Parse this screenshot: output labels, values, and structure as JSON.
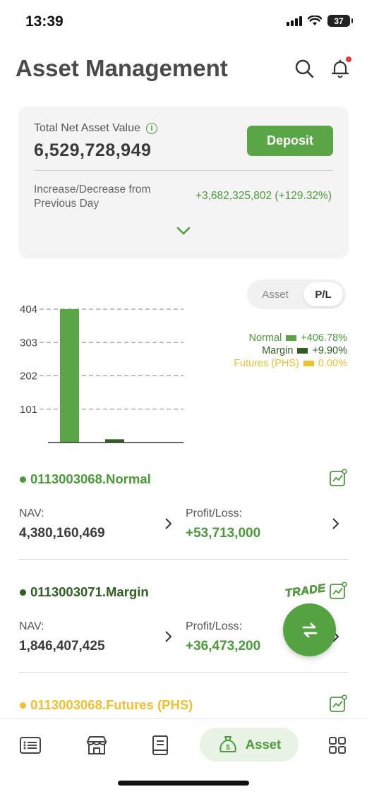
{
  "status_bar": {
    "time": "13:39",
    "battery": "37"
  },
  "header": {
    "title": "Asset Management"
  },
  "summary": {
    "nav_label": "Total Net Asset Value",
    "nav_value": "6,529,728,949",
    "deposit_label": "Deposit",
    "change_label": "Increase/Decrease from Previous Day",
    "change_value": "+3,682,325,802 (+129.32%)"
  },
  "toggle": {
    "asset_label": "Asset",
    "pl_label": "P/L",
    "selected": "P/L"
  },
  "chart_data": {
    "type": "bar",
    "categories": [
      "Normal",
      "Margin",
      "Futures (PHS)"
    ],
    "values": [
      406.78,
      9.9,
      0.0
    ],
    "colors": [
      "#5aa545",
      "#2f5f22",
      "#f0c030"
    ],
    "ytick_labels": [
      "101",
      "202",
      "303",
      "404"
    ],
    "ytick_values": [
      101,
      202,
      303,
      404
    ],
    "ylim": [
      0,
      404
    ],
    "grid": "dashed",
    "legend": [
      {
        "name": "Normal",
        "value": "+406.78%",
        "color": "#4b9a3a"
      },
      {
        "name": "Margin",
        "value": "+9.90%",
        "color": "#2f5f22"
      },
      {
        "name": "Futures (PHS)",
        "value": "0.00%",
        "color": "#f0c030"
      }
    ],
    "legend_position": "right"
  },
  "accounts": [
    {
      "name": "0113003068.Normal",
      "color": "#4b9a3a",
      "nav_label": "NAV:",
      "nav_value": "4,380,160,469",
      "pl_label": "Profit/Loss:",
      "pl_value": "+53,713,000"
    },
    {
      "name": "0113003071.Margin",
      "color": "#2f5f22",
      "nav_label": "NAV:",
      "nav_value": "1,846,407,425",
      "pl_label": "Profit/Loss:",
      "pl_value": "+36,473,200"
    },
    {
      "name": "0113003068.Futures (PHS)",
      "color": "#f0c030"
    }
  ],
  "trade": {
    "label": "TRADE"
  },
  "bottom_nav": {
    "active_label": "Asset"
  },
  "colors": {
    "accent": "#5aa545",
    "positive": "#4b9a3a",
    "dark_green": "#2f5f22",
    "futures": "#f0c030"
  }
}
